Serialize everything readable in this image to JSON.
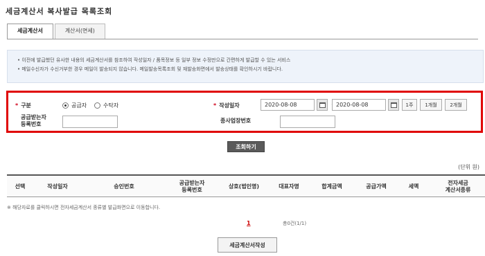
{
  "page": {
    "title": "세금계산서 복사발급 목록조회"
  },
  "tabs": [
    {
      "label": "세금계산서",
      "active": true
    },
    {
      "label": "계산서(면세)",
      "active": false
    }
  ],
  "info": {
    "line1": "• 이전에 발급했던 유사한 내용의 세금계산서를 참조하여 작성일자 / 품목정보 등 일부 정보 수정만으로 간편하게 발급할 수 있는 서비스",
    "line2": "• 메일수신자가 수신거부한 경우 메일이 발송되지 않습니다. 메일발송목록조회 및 재발송화면에서 발송상태를 확인하시기 바랍니다."
  },
  "search": {
    "type_label": "구분",
    "type_options": [
      {
        "label": "공급자",
        "selected": true
      },
      {
        "label": "수탁자",
        "selected": false
      }
    ],
    "date_label": "작성일자",
    "date_from": "2020-08-08",
    "date_to": "2020-08-08",
    "date_separator": "~",
    "quick_buttons": [
      "1주",
      "1개월",
      "2개월"
    ],
    "buyer_reg_label_1": "공급받는자",
    "buyer_reg_label_2": "등록번호",
    "branch_label": "종사업장번호"
  },
  "actions": {
    "search_button": "조회하기",
    "write_button": "세금계산서작성"
  },
  "table": {
    "unit": "(단위 원)",
    "headers": [
      "선택",
      "작성일자",
      "승인번호",
      "공급받는자\n등록번호",
      "상호(법인명)",
      "대표자명",
      "합계금액",
      "공급가액",
      "세액",
      "전자세금\n계산서종류"
    ]
  },
  "note": "※ 해당자료를 클릭하시면 전자세금계산서 종류별 발급화면으로 이동합니다.",
  "pagination": {
    "current": "1",
    "count": "총0건(1/1)"
  },
  "colors": {
    "highlight_border": "#e00000",
    "required": "#d0021b"
  }
}
